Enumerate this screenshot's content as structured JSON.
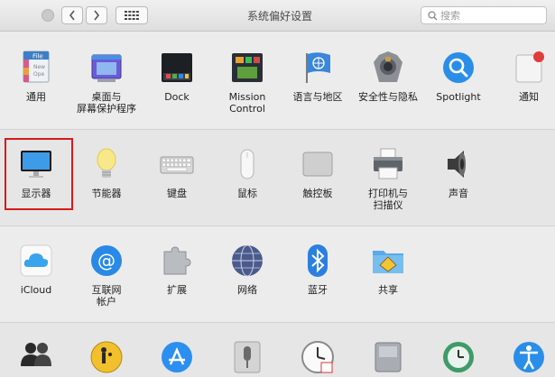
{
  "window": {
    "title": "系统偏好设置",
    "search_placeholder": "搜索"
  },
  "rows": [
    {
      "panes": [
        {
          "label": "通用",
          "icon": "general-icon"
        },
        {
          "label": "桌面与\n屏幕保护程序",
          "icon": "desktop-icon"
        },
        {
          "label": "Dock",
          "icon": "dock-icon"
        },
        {
          "label": "Mission\nControl",
          "icon": "mission-control-icon"
        },
        {
          "label": "语言与地区",
          "icon": "language-icon"
        },
        {
          "label": "安全性与隐私",
          "icon": "security-icon"
        },
        {
          "label": "Spotlight",
          "icon": "spotlight-icon"
        },
        {
          "label": "通知",
          "icon": "notifications-icon"
        }
      ]
    },
    {
      "panes": [
        {
          "label": "显示器",
          "icon": "display-icon"
        },
        {
          "label": "节能器",
          "icon": "energy-saver-icon"
        },
        {
          "label": "键盘",
          "icon": "keyboard-icon"
        },
        {
          "label": "鼠标",
          "icon": "mouse-icon"
        },
        {
          "label": "触控板",
          "icon": "trackpad-icon"
        },
        {
          "label": "打印机与\n扫描仪",
          "icon": "printer-icon"
        },
        {
          "label": "声音",
          "icon": "sound-icon"
        }
      ]
    },
    {
      "panes": [
        {
          "label": "iCloud",
          "icon": "icloud-icon"
        },
        {
          "label": "互联网\n帐户",
          "icon": "internet-accounts-icon"
        },
        {
          "label": "扩展",
          "icon": "extensions-icon"
        },
        {
          "label": "网络",
          "icon": "network-icon"
        },
        {
          "label": "蓝牙",
          "icon": "bluetooth-icon"
        },
        {
          "label": "共享",
          "icon": "sharing-icon"
        }
      ]
    },
    {
      "panes": [
        {
          "icon": "users-icon"
        },
        {
          "icon": "parental-controls-icon"
        },
        {
          "icon": "app-store-icon"
        },
        {
          "icon": "dictation-icon"
        },
        {
          "icon": "date-time-icon"
        },
        {
          "icon": "startup-disk-icon"
        },
        {
          "icon": "time-machine-icon"
        },
        {
          "icon": "accessibility-icon"
        }
      ]
    }
  ],
  "highlighted_pane": "显示器",
  "colors": {
    "highlight": "#d61b1b",
    "accent_blue": "#1e8ff0"
  }
}
